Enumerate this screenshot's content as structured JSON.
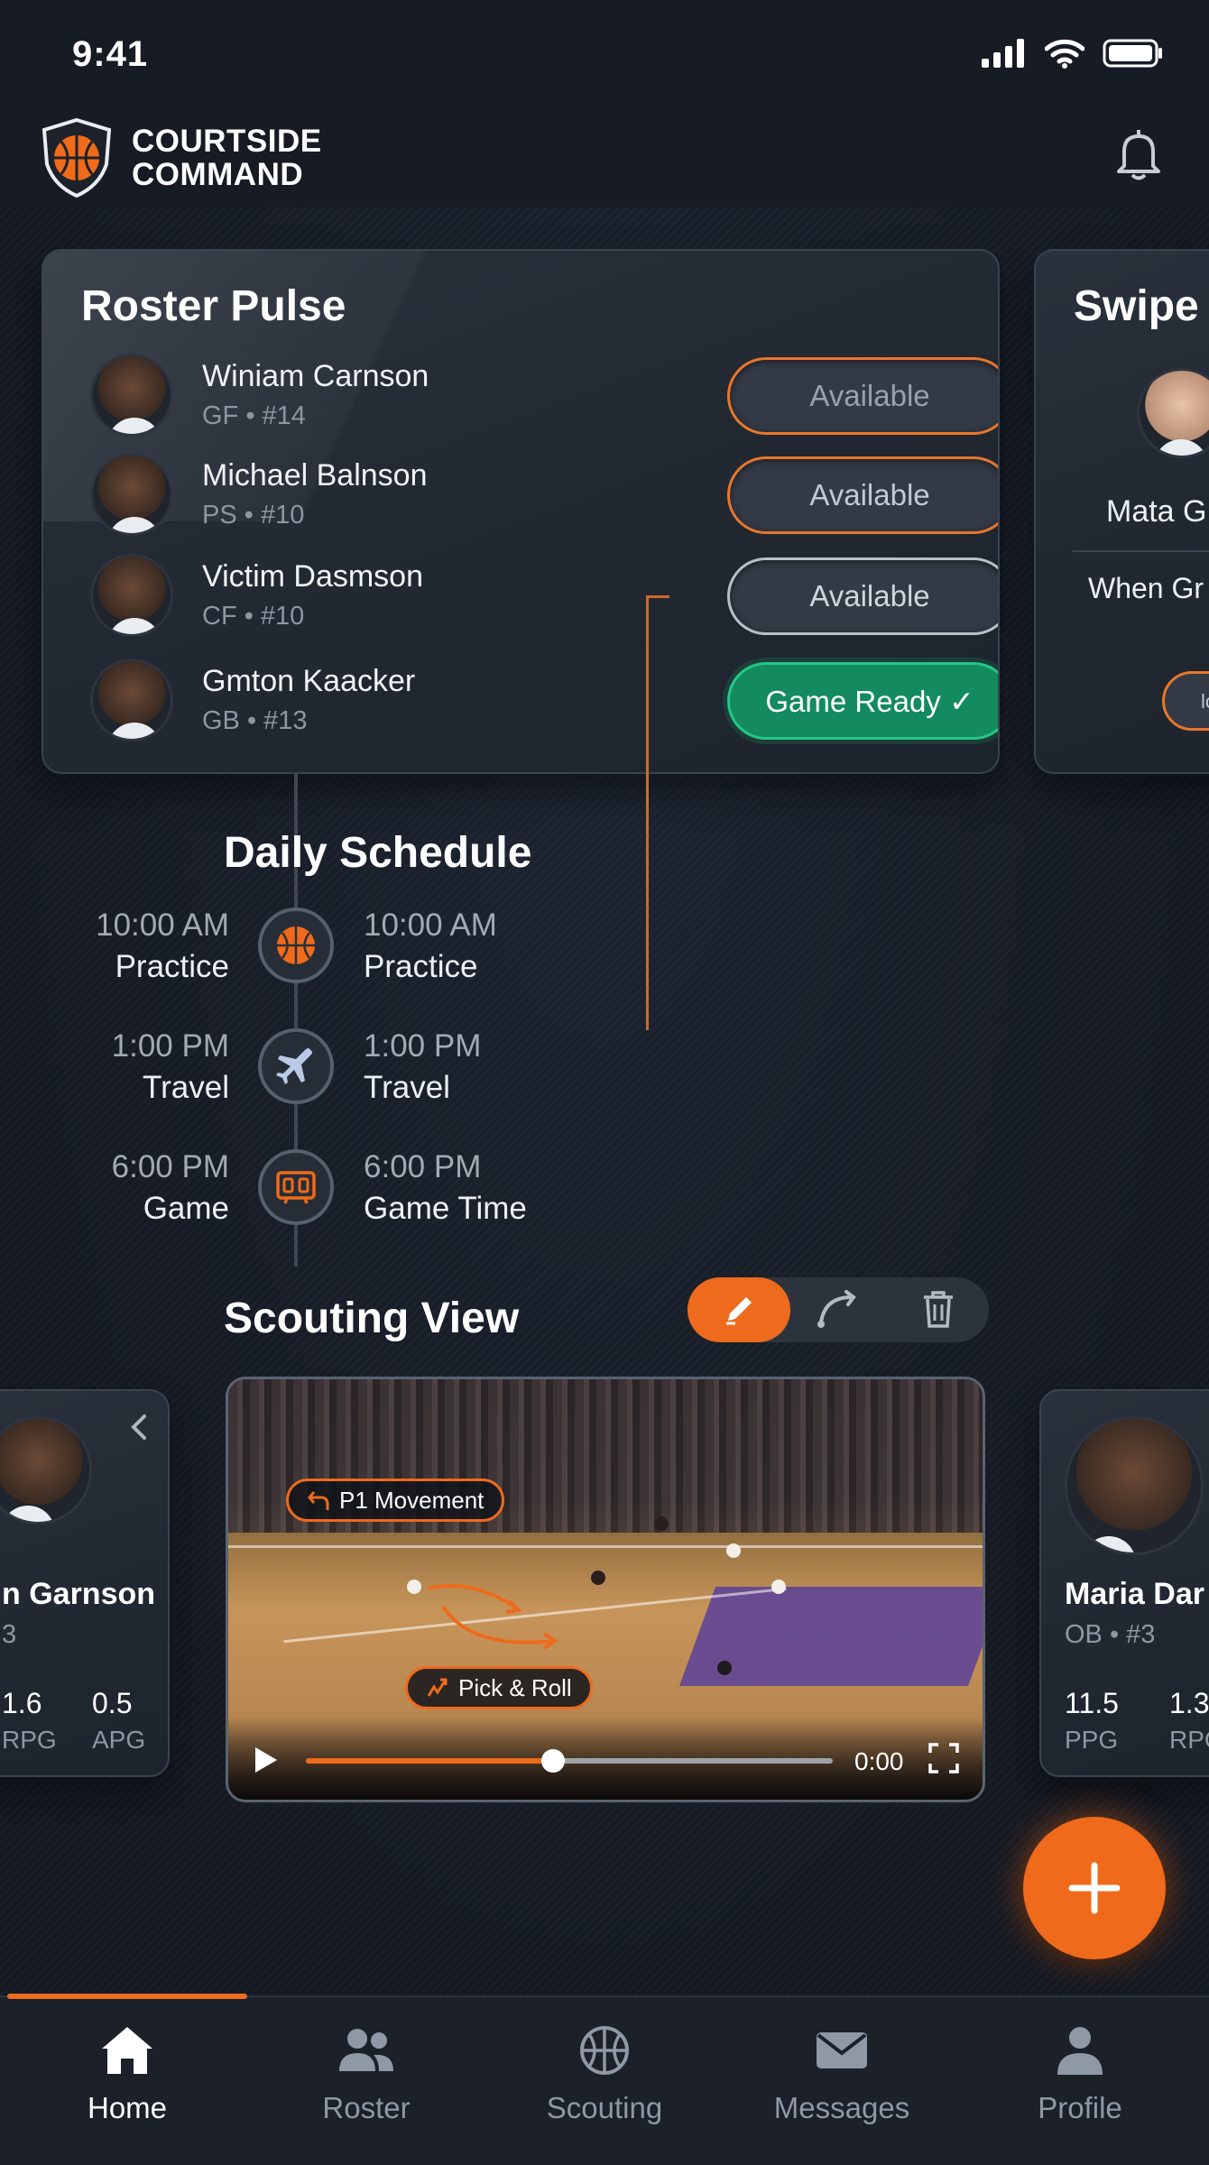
{
  "status_bar": {
    "time": "9:41"
  },
  "brand": {
    "line1": "COURTSIDE",
    "line2": "COMMAND"
  },
  "roster": {
    "title": "Roster Pulse",
    "players": [
      {
        "name": "Winiam Carnson",
        "meta": "GF • #14",
        "status": "Available"
      },
      {
        "name": "Michael Balnson",
        "meta": "PS • #10",
        "status": "Available"
      },
      {
        "name": "Victim Dasmson",
        "meta": "CF • #10",
        "status": "Available"
      },
      {
        "name": "Gmton Kaacker",
        "meta": "GB • #13",
        "status": "Game Ready ✓"
      }
    ]
  },
  "swipe_card": {
    "title": "Swipe",
    "name": "Mata G",
    "subtitle": "When Gr",
    "button": "lo"
  },
  "schedule": {
    "title": "Daily Schedule",
    "items": [
      {
        "left_time": "10:00 AM",
        "left_label": "Practice",
        "right_time": "10:00 AM",
        "right_label": "Practice",
        "icon": "basketball-icon"
      },
      {
        "left_time": "1:00 PM",
        "left_label": "Travel",
        "right_time": "1:00 PM",
        "right_label": "Travel",
        "icon": "airplane-icon"
      },
      {
        "left_time": "6:00 PM",
        "left_label": "Game",
        "right_time": "6:00 PM",
        "right_label": "Game Time",
        "icon": "scoreboard-icon"
      }
    ]
  },
  "scouting": {
    "title": "Scouting View",
    "tools": [
      "pen-icon",
      "curve-icon",
      "trash-icon"
    ],
    "video": {
      "tag1": "P1 Movement",
      "tag2": "Pick & Roll",
      "time": "0:00",
      "progress": 0.47
    },
    "left_card": {
      "name": "n Garnson",
      "meta": "3",
      "stat1_value": "1.6",
      "stat1_label": "RPG",
      "stat2_value": "0.5",
      "stat2_label": "APG"
    },
    "right_card": {
      "name": "Maria Dar",
      "meta": "OB • #3",
      "stat1_value": "11.5",
      "stat1_label": "PPG",
      "stat2_value": "1.3",
      "stat2_label": "RPG"
    }
  },
  "fab": {
    "icon": "plus-icon"
  },
  "tabs": [
    {
      "label": "Home",
      "icon": "home-icon",
      "active": true
    },
    {
      "label": "Roster",
      "icon": "users-icon",
      "active": false
    },
    {
      "label": "Scouting",
      "icon": "basketball-icon",
      "active": false
    },
    {
      "label": "Messages",
      "icon": "mail-icon",
      "active": false
    },
    {
      "label": "Profile",
      "icon": "person-icon",
      "active": false
    }
  ],
  "colors": {
    "accent": "#ee6a1c",
    "ready": "#138b5e",
    "background": "#161b24"
  }
}
